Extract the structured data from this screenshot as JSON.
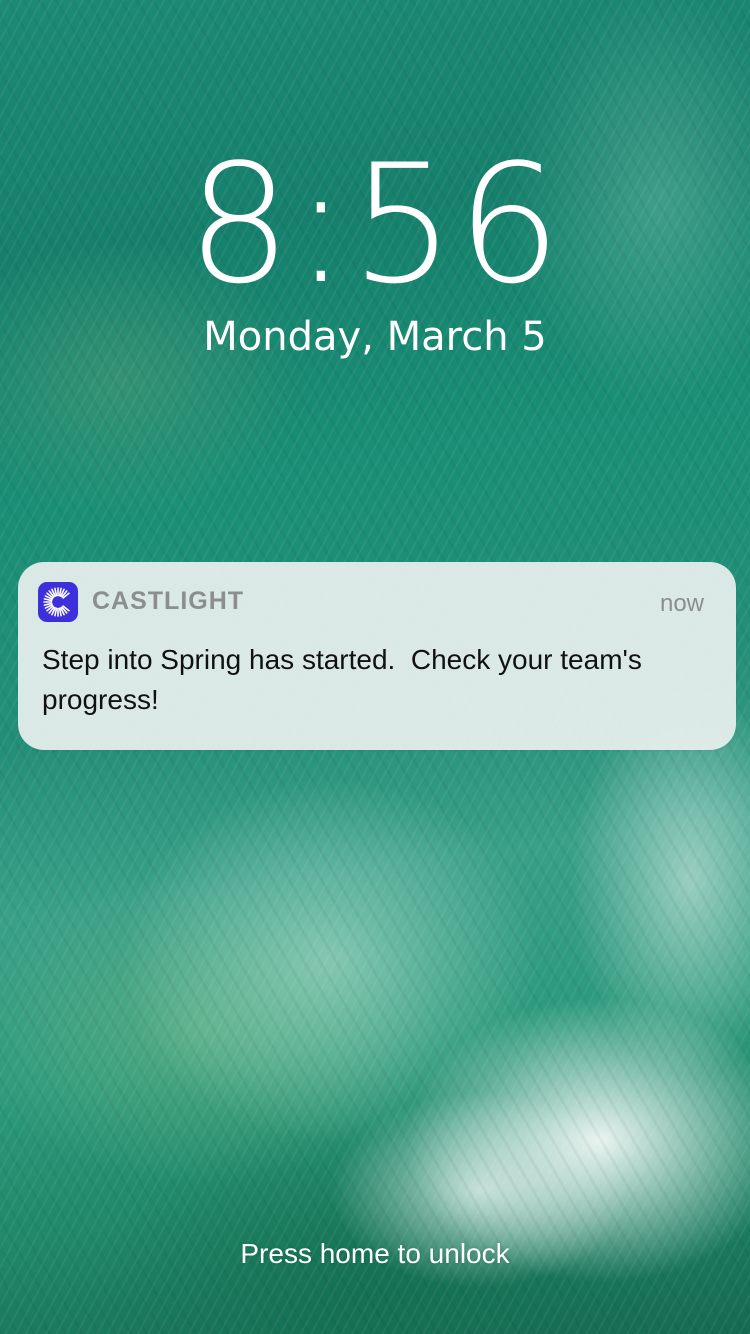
{
  "lockscreen": {
    "time": "8:56",
    "date": "Monday, March 5",
    "unlock_hint": "Press home to unlock"
  },
  "notification": {
    "app_name": "CASTLIGHT",
    "app_icon": "castlight-sunburst-icon",
    "app_icon_color": "#3d2fd9",
    "timestamp": "now",
    "message": "Step into Spring has started.  Check your team's progress!"
  }
}
